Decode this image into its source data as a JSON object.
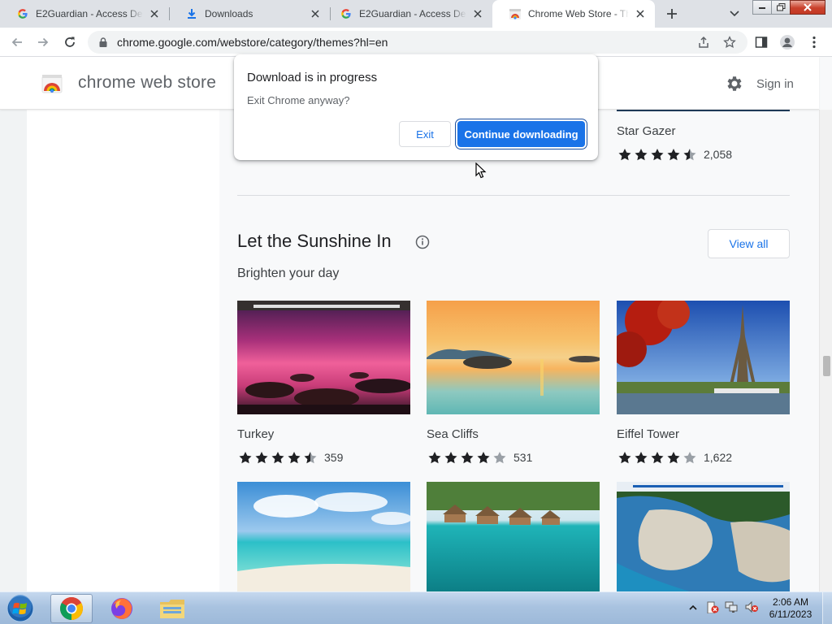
{
  "browser": {
    "tabs": [
      {
        "title": "E2Guardian - Access Denied",
        "icon": "google-g-icon"
      },
      {
        "title": "Downloads",
        "icon": "download-icon"
      },
      {
        "title": "E2Guardian - Access Denied",
        "icon": "google-g-icon"
      },
      {
        "title": "Chrome Web Store - Themes",
        "icon": "webstore-icon",
        "active": true
      }
    ],
    "url_host": "chrome.google.com",
    "url_path": "/webstore/category/themes?hl=en"
  },
  "store": {
    "name": "chrome web store",
    "signin": "Sign in"
  },
  "dialog": {
    "title": "Download is in progress",
    "message": "Exit Chrome anyway?",
    "exit_label": "Exit",
    "continue_label": "Continue downloading"
  },
  "previous_section": {
    "card": {
      "title": "Star Gazer",
      "rating": 4.5,
      "count": "2,058"
    }
  },
  "section": {
    "title": "Let the Sunshine In",
    "subtitle": "Brighten your day",
    "view_all": "View all",
    "cards": [
      {
        "title": "Turkey",
        "rating": 4.5,
        "count": "359"
      },
      {
        "title": "Sea Cliffs",
        "rating": 4,
        "count": "531"
      },
      {
        "title": "Eiffel Tower",
        "rating": 4,
        "count": "1,622"
      }
    ]
  },
  "taskbar": {
    "time": "2:06 AM",
    "date": "6/11/2023",
    "apps": [
      "chrome-icon",
      "firefox-icon",
      "file-explorer-icon"
    ]
  },
  "colors": {
    "accent": "#1a73e8",
    "star": "#202124",
    "star_empty": "#9aa0a6"
  }
}
